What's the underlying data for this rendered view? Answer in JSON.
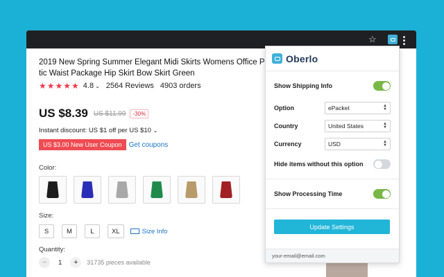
{
  "browser": {
    "star_icon": "star-icon",
    "extension_icon": "oberlo-icon",
    "menu_icon": "more-vertical-icon"
  },
  "product": {
    "title_line1": "2019 New Spring Summer Elegant Midi Skirts Womens Office Pencil Ski",
    "title_line2": "tic Waist Package Hip Skirt Bow Skirt Green",
    "stars": "★★★★★",
    "rating": "4.8",
    "reviews": "2564 Reviews",
    "orders": "4903 orders",
    "price": "US $8.39",
    "old_price": "US $11.99",
    "discount": "-30%",
    "instant_discount": "Instant discount: US $1 off per US $10",
    "coupon": "US $3.00 New User Coupon",
    "get_coupons": "Get coupons",
    "color_label": "Color:",
    "size_label": "Size:",
    "quantity_label": "Quantity:",
    "swatch_colors": [
      "#1d1d1d",
      "#2b2fb8",
      "#a8a8a8",
      "#1f8a4c",
      "#b99a6a",
      "#a11f25"
    ],
    "sizes": [
      "S",
      "M",
      "L",
      "XL"
    ],
    "size_info": "Size Info",
    "qty_minus": "−",
    "qty_value": "1",
    "qty_plus": "+",
    "pieces_available": "31735 pieces available"
  },
  "popup": {
    "brand": "Oberlo",
    "show_shipping_info": "Show Shipping Info",
    "option_label": "Option",
    "option_value": "ePacket",
    "country_label": "Country",
    "country_value": "United States",
    "currency_label": "Currency",
    "currency_value": "USD",
    "hide_items_label": "Hide items without this option",
    "show_processing_label": "Show Processing Time",
    "update_button": "Update Settings",
    "footer_email": "your-email@email.com",
    "toggles": {
      "shipping": true,
      "hide_items": false,
      "processing": true
    },
    "accent_color": "#21b5d8",
    "toggle_on_color": "#79b747"
  }
}
